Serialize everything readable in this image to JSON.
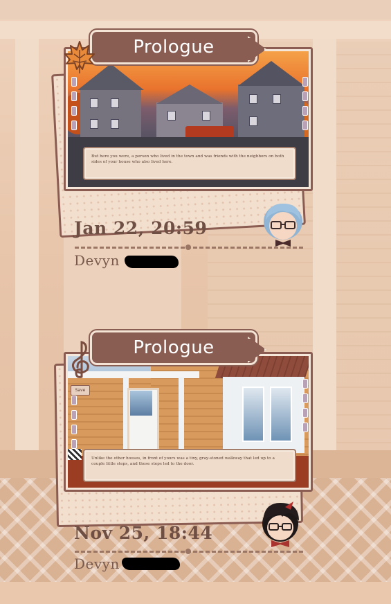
{
  "slots": [
    {
      "chapter": "Prologue",
      "chapter_icon": "maple-leaf-icon",
      "thumbnail_text": "But here you were, a person who lived in the town and was friends with the neighbors on both sides of your house who also lived here.",
      "date": "Jan 22, 20:59",
      "player_name": "Devyn",
      "player_surname_redacted": true,
      "avatar": "avatar-blue-hair-glasses"
    },
    {
      "chapter": "Prologue",
      "chapter_icon": "treble-clef-icon",
      "save_tag": "Save",
      "thumbnail_text": "Unlike the other houses, in front of yours was a tiny, gray-stoned walkway that led up to a couple little steps, and those steps led to the door.",
      "date": "Nov 25, 18:44",
      "player_name": "Devyn",
      "player_surname_redacted": true,
      "avatar": "avatar-black-hair-glasses"
    }
  ],
  "colors": {
    "banner": "#8a5d53",
    "date_text": "#6f4e43",
    "background": "#e9c8ad"
  }
}
